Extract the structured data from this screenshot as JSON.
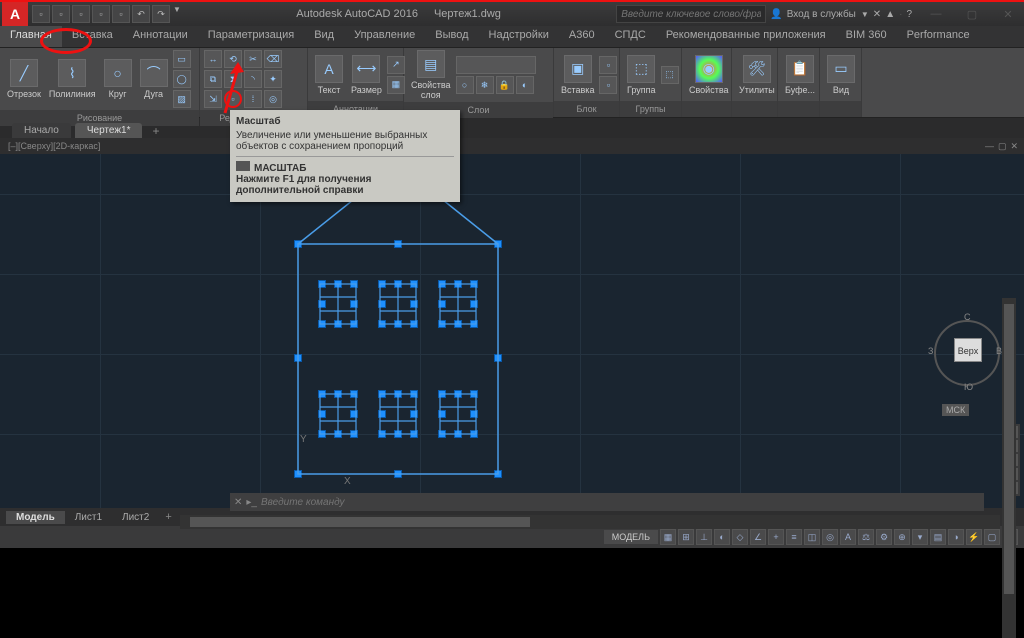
{
  "titlebar": {
    "app_name": "Autodesk AutoCAD 2016",
    "document": "Чертеж1.dwg",
    "search_placeholder": "Введите ключевое слово/фразу",
    "login_label": "Вход в службы",
    "help_icon": "?"
  },
  "ribbon_tabs": [
    "Главная",
    "Вставка",
    "Аннотации",
    "Параметризация",
    "Вид",
    "Управление",
    "Вывод",
    "Надстройки",
    "A360",
    "СПДС",
    "Рекомендованные приложения",
    "BIM 360",
    "Performance"
  ],
  "panels": {
    "draw": {
      "title": "Рисование",
      "tools": [
        "Отрезок",
        "Полилиния",
        "Круг",
        "Дуга"
      ]
    },
    "modify": {
      "title": "Редактирование"
    },
    "annot": {
      "title": "Аннотации",
      "text": "Текст",
      "dim": "Размер"
    },
    "layers": {
      "title": "Слои",
      "props": "Свойства\nслоя"
    },
    "block": {
      "title": "Блок",
      "insert": "Вставка"
    },
    "groups": {
      "title": "Группы",
      "group": "Группа"
    },
    "props": {
      "title": "Свойства"
    },
    "utils": {
      "title": "Утилиты"
    },
    "clip": {
      "title": "Буфе..."
    },
    "view": {
      "title": "Вид"
    }
  },
  "filetabs": {
    "start": "Начало",
    "active": "Чертеж1*"
  },
  "viewport_label": "[–][Сверху][2D-каркас]",
  "tooltip": {
    "title": "Масштаб",
    "desc": "Увеличение или уменьшение выбранных объектов с сохранением пропорций",
    "cmd": "МАСШТАБ",
    "help": "Нажмите F1 для получения дополнительной справки"
  },
  "viewcube": {
    "face": "Верх",
    "n": "С",
    "s": "Ю",
    "w": "З",
    "e": "В",
    "wcs": "МСК"
  },
  "cmdline": {
    "placeholder": "Введите команду"
  },
  "layout_tabs": [
    "Модель",
    "Лист1",
    "Лист2"
  ],
  "status": {
    "model": "МОДЕЛЬ"
  }
}
